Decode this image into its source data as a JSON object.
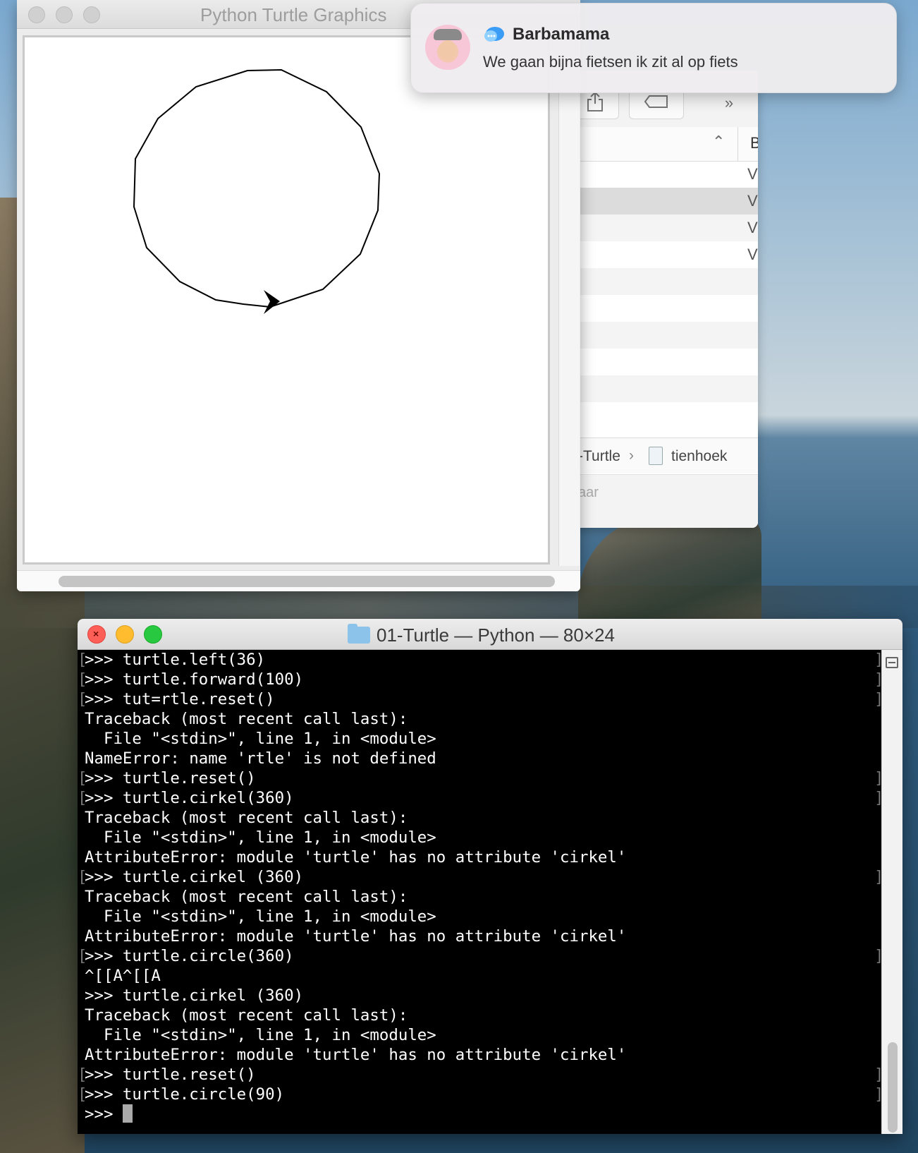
{
  "turtle_window": {
    "title": "Python Turtle Graphics"
  },
  "notification": {
    "sender": "Barbamama",
    "message": "We gaan bijna fietsen ik zit al op fiets",
    "app_icon": "messages-icon"
  },
  "finder": {
    "toolbar": {
      "share_icon": "share-icon",
      "tag_icon": "tag-icon",
      "more_icon": "chevron-double-right-icon"
    },
    "column_header": "B",
    "rows": [
      "V",
      "V",
      "V",
      "V"
    ],
    "path": {
      "folder": "-Turtle",
      "separator": "›",
      "file": "tienhoek"
    },
    "status": "aar"
  },
  "terminal": {
    "title": "01-Turtle — Python — 80×24",
    "lines": [
      ">>> turtle.left(36)",
      ">>> turtle.forward(100)",
      ">>> tut=rtle.reset()",
      "Traceback (most recent call last):",
      "  File \"<stdin>\", line 1, in <module>",
      "NameError: name 'rtle' is not defined",
      ">>> turtle.reset()",
      ">>> turtle.cirkel(360)",
      "Traceback (most recent call last):",
      "  File \"<stdin>\", line 1, in <module>",
      "AttributeError: module 'turtle' has no attribute 'cirkel'",
      ">>> turtle.cirkel (360)",
      "Traceback (most recent call last):",
      "  File \"<stdin>\", line 1, in <module>",
      "AttributeError: module 'turtle' has no attribute 'cirkel'",
      ">>> turtle.circle(360)",
      "^[[A^[[A",
      ">>> turtle.cirkel (360)",
      "Traceback (most recent call last):",
      "  File \"<stdin>\", line 1, in <module>",
      "AttributeError: module 'turtle' has no attribute 'cirkel'",
      ">>> turtle.reset()",
      ">>> turtle.circle(90)",
      ">>> "
    ]
  }
}
